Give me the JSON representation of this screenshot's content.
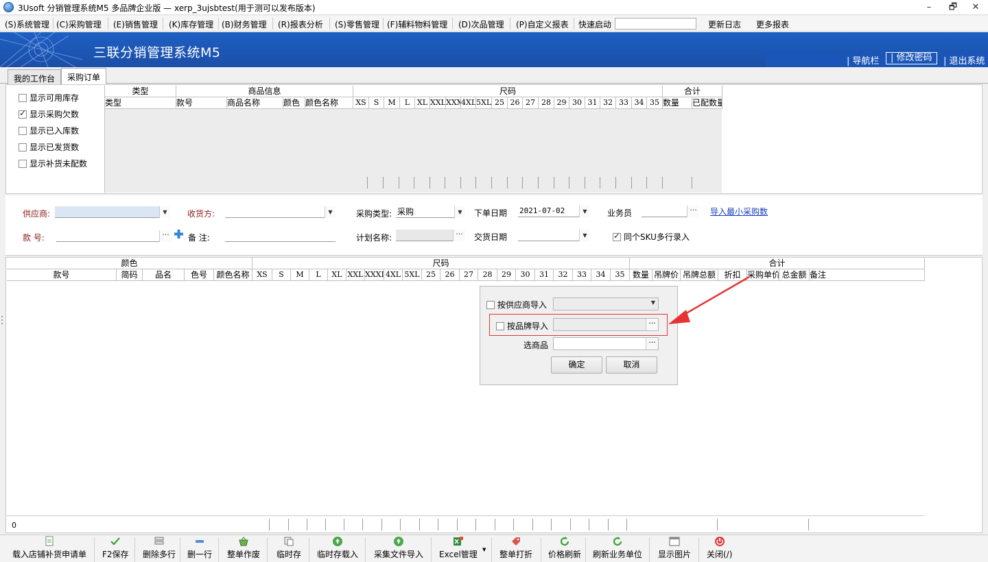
{
  "window": {
    "title": "3Usoft 分销管理系统M5 多品牌企业版 — xerp_3ujsbtest(用于测可以发布版本)",
    "controls": [
      "–",
      "🗗",
      "✕"
    ]
  },
  "menu": {
    "items": [
      "(S)系统管理",
      "(C)采购管理",
      "(E)销售管理",
      "(K)库存管理",
      "(B)财务管理",
      "(R)报表分析",
      "(S)零售管理",
      "(F)辅料物料管理",
      "(D)次品管理",
      "(P)自定义报表"
    ],
    "quick_start_label": "快速启动",
    "quick_start_value": "",
    "changelog": "更新日志",
    "more_reports": "更多报表"
  },
  "banner": {
    "title": "三联分销管理系统M5",
    "nav": "导航栏",
    "change_password": "修改密码",
    "logout": "退出系统"
  },
  "tabs": [
    "我的工作台",
    "采购订单"
  ],
  "options": [
    {
      "label": "显示可用库存",
      "checked": false
    },
    {
      "label": "显示采购欠数",
      "checked": true
    },
    {
      "label": "显示已入库数",
      "checked": false
    },
    {
      "label": "显示已发货数",
      "checked": false
    },
    {
      "label": "显示补货未配数",
      "checked": false
    }
  ],
  "grid1": {
    "groups": [
      "类型",
      "商品信息",
      "尺码",
      "合计"
    ],
    "columns": [
      "类型",
      "款号",
      "商品名称",
      "颜色",
      "颜色名称",
      "XS",
      "S",
      "M",
      "L",
      "XL",
      "XXL",
      "XXX",
      "4XL",
      "5XL",
      "25",
      "26",
      "27",
      "28",
      "29",
      "30",
      "31",
      "32",
      "33",
      "34",
      "35",
      "数量",
      "已配数量"
    ]
  },
  "form": {
    "supplier_label": "供应商:",
    "supplier_value": "",
    "receiver_label": "收货方:",
    "receiver_value": "",
    "purchase_type_label": "采购类型:",
    "purchase_type_value": "采购",
    "order_date_label": "下单日期",
    "order_date_value": "2021-07-02",
    "salesman_label": "业务员",
    "salesman_value": "",
    "import_min_link": "导入最小采购数",
    "style_no_label": "款  号:",
    "style_no_value": "",
    "remark_label": "备  注:",
    "remark_value": "",
    "plan_name_label": "计划名称:",
    "plan_name_value": "",
    "delivery_date_label": "交货日期",
    "delivery_date_value": "",
    "same_sku_label": "同个SKU多行录入",
    "same_sku_checked": true
  },
  "grid2": {
    "groups": [
      "颜色",
      "尺码",
      "合计"
    ],
    "columns": [
      "款号",
      "简码",
      "品名",
      "色号",
      "颜色名称",
      "XS",
      "S",
      "M",
      "L",
      "XL",
      "XXL",
      "XXXL",
      "4XL",
      "5XL",
      "25",
      "26",
      "27",
      "28",
      "29",
      "30",
      "31",
      "32",
      "33",
      "34",
      "35",
      "数量",
      "吊牌价",
      "吊牌总额",
      "折扣",
      "采购单价",
      "总金额",
      "备注"
    ],
    "footer_count": "0"
  },
  "dialog": {
    "by_supplier_label": "按供应商导入",
    "by_brand_label": "按品牌导入",
    "select_product_label": "选商品",
    "ok": "确定",
    "cancel": "取消"
  },
  "toolbar": {
    "buttons": [
      "载入店铺补货申请单",
      "F2保存",
      "删除多行",
      "删一行",
      "整单作废",
      "临时存",
      "临时存载入",
      "采集文件导入",
      "Excel管理",
      "整单打折",
      "价格刷新",
      "刷新业务单位",
      "显示图片",
      "关闭(/)"
    ]
  },
  "colors": {
    "banner": "#1c4fa8",
    "highlight_box": "#e53333",
    "link": "#1a3fb8"
  }
}
